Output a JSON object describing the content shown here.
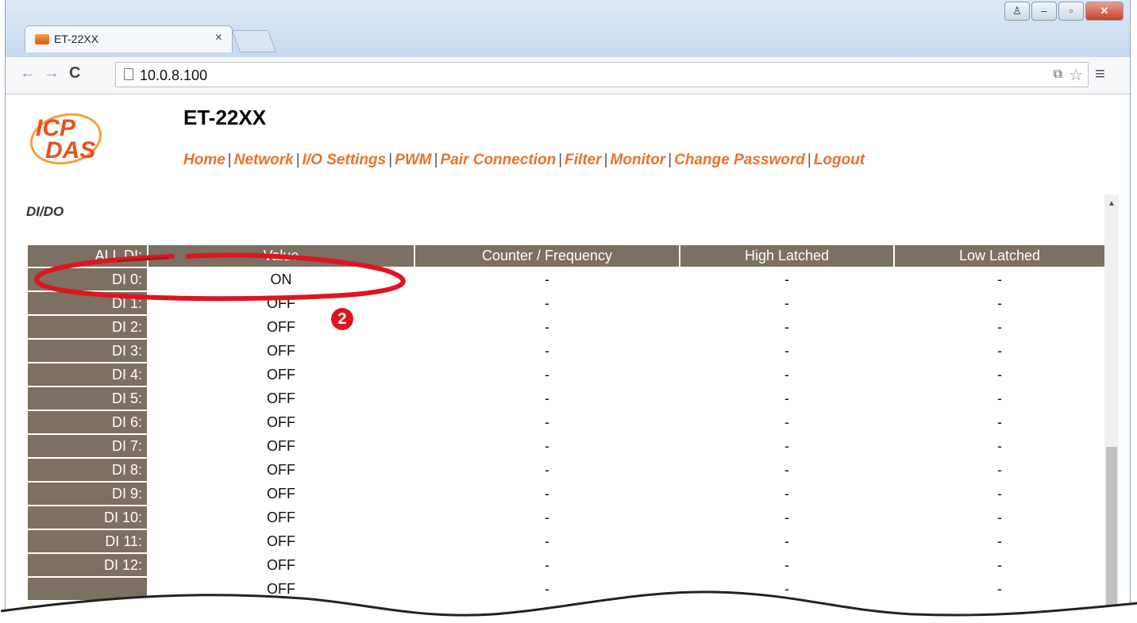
{
  "window": {
    "tab_title": "ET-22XX",
    "tab_close": "×",
    "controls": [
      "♙",
      "‒",
      "▫",
      "✕"
    ]
  },
  "toolbar": {
    "url": "10.0.8.100",
    "back_icon": "back-arrow-icon",
    "forward_icon": "forward-arrow-icon",
    "reload_icon": "reload-icon"
  },
  "header": {
    "logo_text": [
      "ICP",
      "DAS"
    ],
    "title": "ET-22XX",
    "nav": [
      "Home",
      "Network",
      "I/O Settings",
      "PWM",
      "Pair Connection",
      "Filter",
      "Monitor",
      "Change Password",
      "Logout"
    ]
  },
  "section": {
    "title": "DI/DO"
  },
  "table": {
    "headers": [
      "ALL DI:",
      "Value",
      "Counter / Frequency",
      "High Latched",
      "Low Latched"
    ],
    "rows": [
      {
        "label": "DI 0:",
        "value": "ON",
        "counter": "-",
        "high": "-",
        "low": "-"
      },
      {
        "label": "DI 1:",
        "value": "OFF",
        "counter": "-",
        "high": "-",
        "low": "-"
      },
      {
        "label": "DI 2:",
        "value": "OFF",
        "counter": "-",
        "high": "-",
        "low": "-"
      },
      {
        "label": "DI 3:",
        "value": "OFF",
        "counter": "-",
        "high": "-",
        "low": "-"
      },
      {
        "label": "DI 4:",
        "value": "OFF",
        "counter": "-",
        "high": "-",
        "low": "-"
      },
      {
        "label": "DI 5:",
        "value": "OFF",
        "counter": "-",
        "high": "-",
        "low": "-"
      },
      {
        "label": "DI 6:",
        "value": "OFF",
        "counter": "-",
        "high": "-",
        "low": "-"
      },
      {
        "label": "DI 7:",
        "value": "OFF",
        "counter": "-",
        "high": "-",
        "low": "-"
      },
      {
        "label": "DI 8:",
        "value": "OFF",
        "counter": "-",
        "high": "-",
        "low": "-"
      },
      {
        "label": "DI 9:",
        "value": "OFF",
        "counter": "-",
        "high": "-",
        "low": "-"
      },
      {
        "label": "DI 10:",
        "value": "OFF",
        "counter": "-",
        "high": "-",
        "low": "-"
      },
      {
        "label": "DI 11:",
        "value": "OFF",
        "counter": "-",
        "high": "-",
        "low": "-"
      },
      {
        "label": "DI 12:",
        "value": "OFF",
        "counter": "-",
        "high": "-",
        "low": "-"
      },
      {
        "label": "",
        "value": "OFF",
        "counter": "-",
        "high": "-",
        "low": "-"
      }
    ]
  },
  "annotation": {
    "step": "2"
  },
  "colors": {
    "header_bg": "#7b7061",
    "nav_link": "#e8722c",
    "annotation": "#e0141d"
  }
}
